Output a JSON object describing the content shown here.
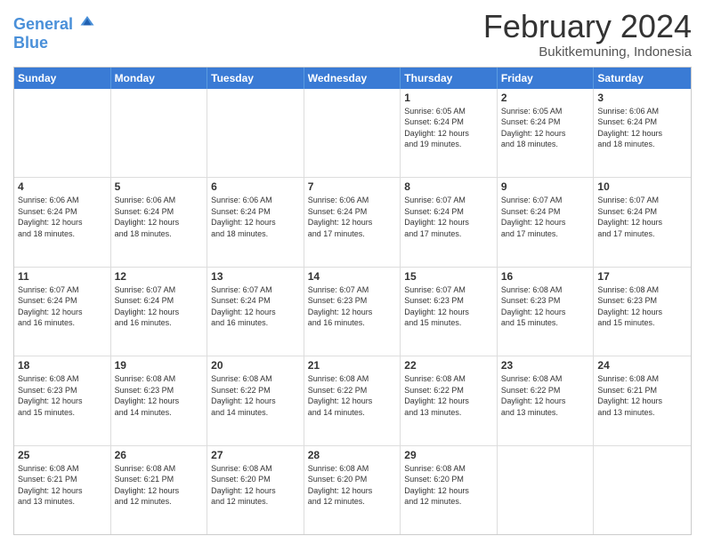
{
  "logo": {
    "line1": "General",
    "line2": "Blue"
  },
  "title": "February 2024",
  "subtitle": "Bukitkemuning, Indonesia",
  "days": [
    "Sunday",
    "Monday",
    "Tuesday",
    "Wednesday",
    "Thursday",
    "Friday",
    "Saturday"
  ],
  "weeks": [
    [
      {
        "day": "",
        "info": ""
      },
      {
        "day": "",
        "info": ""
      },
      {
        "day": "",
        "info": ""
      },
      {
        "day": "",
        "info": ""
      },
      {
        "day": "1",
        "info": "Sunrise: 6:05 AM\nSunset: 6:24 PM\nDaylight: 12 hours\nand 19 minutes."
      },
      {
        "day": "2",
        "info": "Sunrise: 6:05 AM\nSunset: 6:24 PM\nDaylight: 12 hours\nand 18 minutes."
      },
      {
        "day": "3",
        "info": "Sunrise: 6:06 AM\nSunset: 6:24 PM\nDaylight: 12 hours\nand 18 minutes."
      }
    ],
    [
      {
        "day": "4",
        "info": "Sunrise: 6:06 AM\nSunset: 6:24 PM\nDaylight: 12 hours\nand 18 minutes."
      },
      {
        "day": "5",
        "info": "Sunrise: 6:06 AM\nSunset: 6:24 PM\nDaylight: 12 hours\nand 18 minutes."
      },
      {
        "day": "6",
        "info": "Sunrise: 6:06 AM\nSunset: 6:24 PM\nDaylight: 12 hours\nand 18 minutes."
      },
      {
        "day": "7",
        "info": "Sunrise: 6:06 AM\nSunset: 6:24 PM\nDaylight: 12 hours\nand 17 minutes."
      },
      {
        "day": "8",
        "info": "Sunrise: 6:07 AM\nSunset: 6:24 PM\nDaylight: 12 hours\nand 17 minutes."
      },
      {
        "day": "9",
        "info": "Sunrise: 6:07 AM\nSunset: 6:24 PM\nDaylight: 12 hours\nand 17 minutes."
      },
      {
        "day": "10",
        "info": "Sunrise: 6:07 AM\nSunset: 6:24 PM\nDaylight: 12 hours\nand 17 minutes."
      }
    ],
    [
      {
        "day": "11",
        "info": "Sunrise: 6:07 AM\nSunset: 6:24 PM\nDaylight: 12 hours\nand 16 minutes."
      },
      {
        "day": "12",
        "info": "Sunrise: 6:07 AM\nSunset: 6:24 PM\nDaylight: 12 hours\nand 16 minutes."
      },
      {
        "day": "13",
        "info": "Sunrise: 6:07 AM\nSunset: 6:24 PM\nDaylight: 12 hours\nand 16 minutes."
      },
      {
        "day": "14",
        "info": "Sunrise: 6:07 AM\nSunset: 6:23 PM\nDaylight: 12 hours\nand 16 minutes."
      },
      {
        "day": "15",
        "info": "Sunrise: 6:07 AM\nSunset: 6:23 PM\nDaylight: 12 hours\nand 15 minutes."
      },
      {
        "day": "16",
        "info": "Sunrise: 6:08 AM\nSunset: 6:23 PM\nDaylight: 12 hours\nand 15 minutes."
      },
      {
        "day": "17",
        "info": "Sunrise: 6:08 AM\nSunset: 6:23 PM\nDaylight: 12 hours\nand 15 minutes."
      }
    ],
    [
      {
        "day": "18",
        "info": "Sunrise: 6:08 AM\nSunset: 6:23 PM\nDaylight: 12 hours\nand 15 minutes."
      },
      {
        "day": "19",
        "info": "Sunrise: 6:08 AM\nSunset: 6:23 PM\nDaylight: 12 hours\nand 14 minutes."
      },
      {
        "day": "20",
        "info": "Sunrise: 6:08 AM\nSunset: 6:22 PM\nDaylight: 12 hours\nand 14 minutes."
      },
      {
        "day": "21",
        "info": "Sunrise: 6:08 AM\nSunset: 6:22 PM\nDaylight: 12 hours\nand 14 minutes."
      },
      {
        "day": "22",
        "info": "Sunrise: 6:08 AM\nSunset: 6:22 PM\nDaylight: 12 hours\nand 13 minutes."
      },
      {
        "day": "23",
        "info": "Sunrise: 6:08 AM\nSunset: 6:22 PM\nDaylight: 12 hours\nand 13 minutes."
      },
      {
        "day": "24",
        "info": "Sunrise: 6:08 AM\nSunset: 6:21 PM\nDaylight: 12 hours\nand 13 minutes."
      }
    ],
    [
      {
        "day": "25",
        "info": "Sunrise: 6:08 AM\nSunset: 6:21 PM\nDaylight: 12 hours\nand 13 minutes."
      },
      {
        "day": "26",
        "info": "Sunrise: 6:08 AM\nSunset: 6:21 PM\nDaylight: 12 hours\nand 12 minutes."
      },
      {
        "day": "27",
        "info": "Sunrise: 6:08 AM\nSunset: 6:20 PM\nDaylight: 12 hours\nand 12 minutes."
      },
      {
        "day": "28",
        "info": "Sunrise: 6:08 AM\nSunset: 6:20 PM\nDaylight: 12 hours\nand 12 minutes."
      },
      {
        "day": "29",
        "info": "Sunrise: 6:08 AM\nSunset: 6:20 PM\nDaylight: 12 hours\nand 12 minutes."
      },
      {
        "day": "",
        "info": ""
      },
      {
        "day": "",
        "info": ""
      }
    ]
  ]
}
